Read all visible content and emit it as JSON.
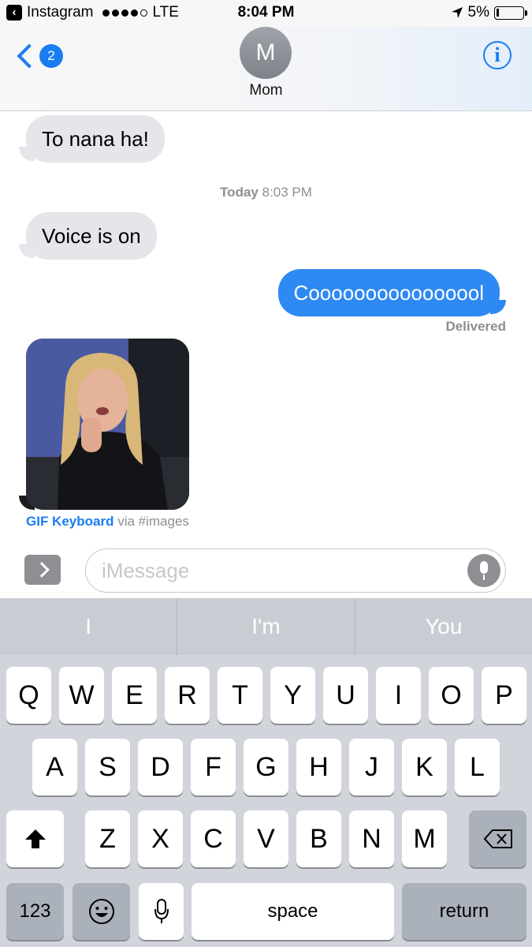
{
  "status_bar": {
    "back_app": "Instagram",
    "carrier": "LTE",
    "time": "8:04 PM",
    "battery": "5%"
  },
  "nav": {
    "back_badge": "2",
    "avatar_initial": "M",
    "contact_name": "Mom",
    "info_icon": "info-icon"
  },
  "messages": {
    "m1": "To nana ha!",
    "timestamp_day": "Today",
    "timestamp_time": "8:03 PM",
    "m2": "Voice is on",
    "m3": "Coooooooooooooool",
    "delivered": "Delivered"
  },
  "gif": {
    "source": "GIF Keyboard",
    "via": "via #images"
  },
  "input": {
    "placeholder": "iMessage"
  },
  "keyboard": {
    "suggestions": [
      "I",
      "I'm",
      "You"
    ],
    "row1": [
      "Q",
      "W",
      "E",
      "R",
      "T",
      "Y",
      "U",
      "I",
      "O",
      "P"
    ],
    "row2": [
      "A",
      "S",
      "D",
      "F",
      "G",
      "H",
      "J",
      "K",
      "L"
    ],
    "row3": [
      "Z",
      "X",
      "C",
      "V",
      "B",
      "N",
      "M"
    ],
    "numbers": "123",
    "space": "space",
    "return": "return"
  },
  "colors": {
    "accent": "#1a7cf2",
    "outgoing_bubble": "#2e89f3",
    "incoming_bubble": "#e5e5ea"
  }
}
